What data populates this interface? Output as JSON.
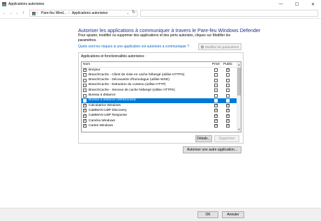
{
  "window": {
    "title": "Applications autorisées",
    "minimize_glyph": "—",
    "maximize_glyph": "☐",
    "close_glyph": "✕"
  },
  "nav": {
    "back_glyph": "←",
    "forward_glyph": "→",
    "recent_glyph": "⌄",
    "up_glyph": "↑",
    "breadcrumb": [
      "Pare-feu Wind...",
      "Applications autorisées"
    ],
    "separator": "›",
    "dropdown_glyph": "⌄",
    "refresh_glyph": "↻",
    "search_placeholder": ""
  },
  "main": {
    "heading": "Autoriser les applications à communiquer à travers le Pare-feu Windows Defender",
    "description": "Pour ajouter, modifier ou supprimer des applications et des ports autorisés, cliquez sur Modifier les paramètres.",
    "risk_link": "Quels sont les risques si une application est autorisée à communiquer ?",
    "modify_button": "Modifier les paramètres"
  },
  "list": {
    "group_label": "Applications et fonctionnalités autorisées :",
    "columns": {
      "name": "Nom",
      "private": "Privé",
      "public": "Public"
    },
    "scroll_up_glyph": "▲",
    "scroll_down_glyph": "▼",
    "selected_index": 6,
    "items": [
      {
        "name": "Bonjour",
        "enabled": true,
        "private": false,
        "public": true
      },
      {
        "name": "BranchCache - Client de mise en cache hébergé (utilise HTTPS)",
        "enabled": false,
        "private": false,
        "public": false
      },
      {
        "name": "BranchCache - Découverte d'homologue (utilise WSD)",
        "enabled": false,
        "private": false,
        "public": false
      },
      {
        "name": "BranchCache - Extraction du contenu (utilise HTTP)",
        "enabled": false,
        "private": false,
        "public": false
      },
      {
        "name": "BranchCache - Serveur de cache hébergé (utilise HTTPS)",
        "enabled": false,
        "private": false,
        "public": false
      },
      {
        "name": "Bureau à distance",
        "enabled": false,
        "private": false,
        "public": false
      },
      {
        "name": "Bureau à distance (WebSocket)",
        "enabled": false,
        "private": false,
        "public": false
      },
      {
        "name": "Calculatrice Windows",
        "enabled": true,
        "private": true,
        "public": true
      },
      {
        "name": "CaMMAN UDP Discovery",
        "enabled": true,
        "private": true,
        "public": true
      },
      {
        "name": "CaMMAN UDP Response",
        "enabled": true,
        "private": true,
        "public": true
      },
      {
        "name": "Caméra Windows",
        "enabled": true,
        "private": true,
        "public": true
      },
      {
        "name": "Cartes Windows",
        "enabled": true,
        "private": true,
        "public": true
      }
    ]
  },
  "buttons": {
    "details": "Détails...",
    "remove": "Supprimer",
    "allow_other": "Autoriser une autre application...",
    "ok": "OK",
    "cancel": "Annuler"
  }
}
